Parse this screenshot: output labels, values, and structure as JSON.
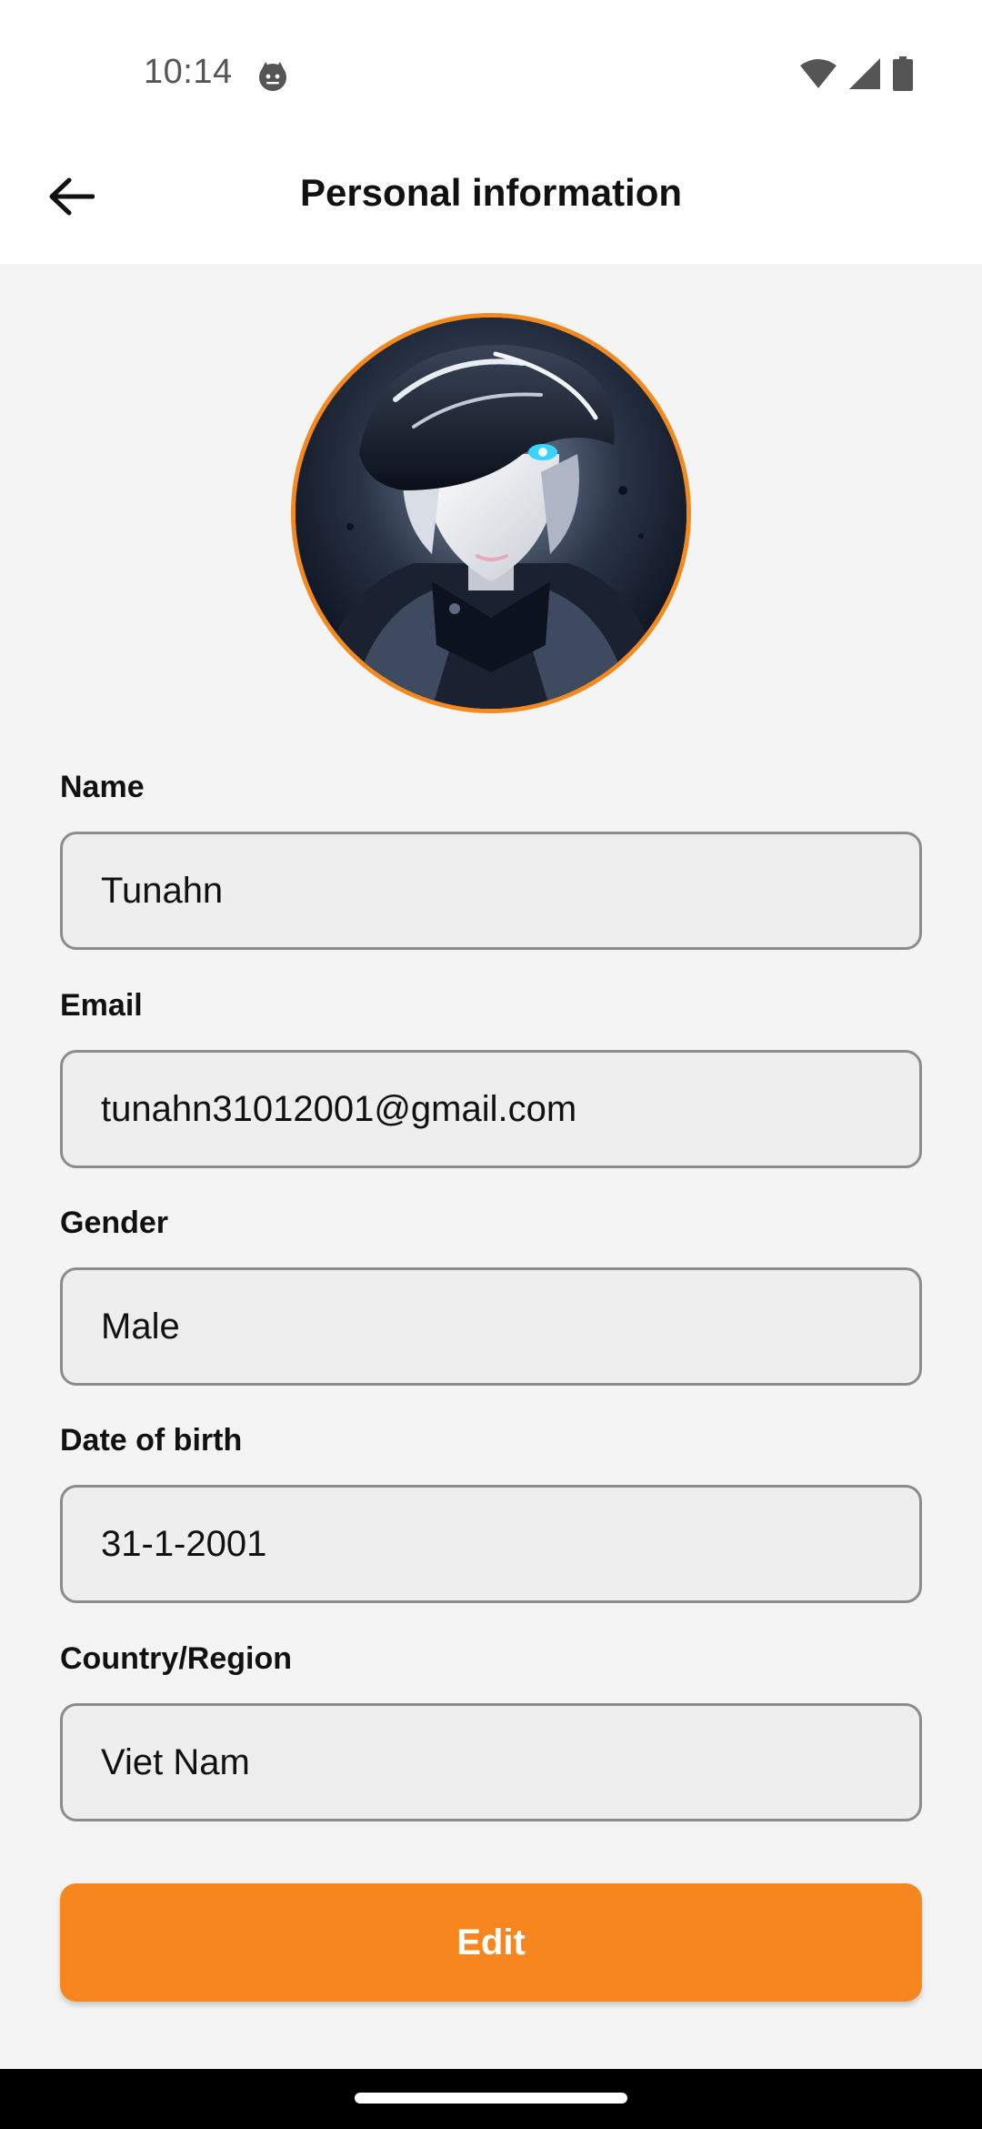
{
  "status_bar": {
    "time": "10:14",
    "app_icon": "cat-face-icon",
    "right_icons": [
      "wifi-icon",
      "cellular-signal-icon",
      "battery-icon"
    ]
  },
  "header": {
    "title": "Personal information",
    "back_icon": "arrow-left-icon"
  },
  "avatar": {
    "border_color": "#f38a20"
  },
  "form": {
    "fields": [
      {
        "label": "Name",
        "value": "Tunahn"
      },
      {
        "label": "Email",
        "value": "tunahn31012001@gmail.com"
      },
      {
        "label": "Gender",
        "value": "Male"
      },
      {
        "label": "Date of birth",
        "value": "31-1-2001"
      },
      {
        "label": "Country/Region",
        "value": "Viet Nam"
      }
    ]
  },
  "actions": {
    "edit_label": "Edit"
  },
  "colors": {
    "accent": "#f8861e",
    "background": "#f4f4f4",
    "field_background": "#eeeeee",
    "field_border": "#8c8c8c"
  }
}
